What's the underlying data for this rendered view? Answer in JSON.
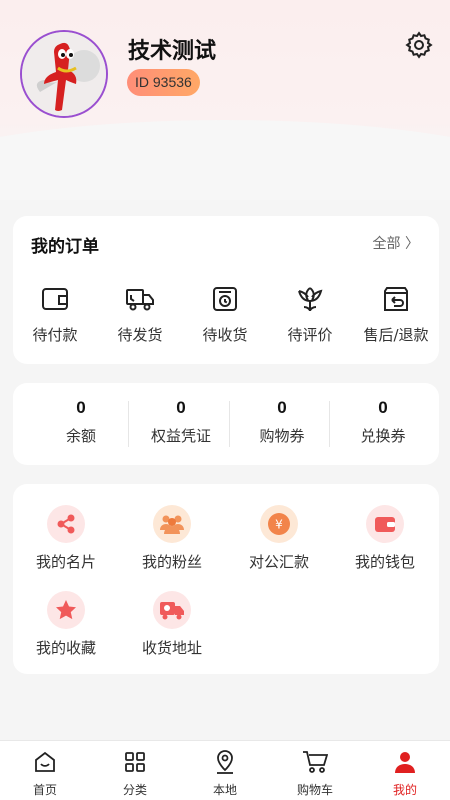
{
  "profile": {
    "name": "技术测试",
    "id_label": "ID 93536"
  },
  "orders": {
    "title": "我的订单",
    "all_label": "全部 〉",
    "items": [
      {
        "label": "待付款",
        "icon": "wallet-icon"
      },
      {
        "label": "待发货",
        "icon": "truck-icon"
      },
      {
        "label": "待收货",
        "icon": "package-clock-icon"
      },
      {
        "label": "待评价",
        "icon": "flower-icon"
      },
      {
        "label": "售后/退款",
        "icon": "return-icon"
      }
    ]
  },
  "stats": [
    {
      "value": "0",
      "label": "余额"
    },
    {
      "value": "0",
      "label": "权益凭证"
    },
    {
      "value": "0",
      "label": "购物券"
    },
    {
      "value": "0",
      "label": "兑换券"
    }
  ],
  "services": [
    {
      "label": "我的名片",
      "icon": "share-icon"
    },
    {
      "label": "我的粉丝",
      "icon": "fans-icon"
    },
    {
      "label": "对公汇款",
      "icon": "yuan-icon"
    },
    {
      "label": "我的钱包",
      "icon": "wallet-icon"
    },
    {
      "label": "我的收藏",
      "icon": "star-icon"
    },
    {
      "label": "收货地址",
      "icon": "delivery-truck-icon"
    }
  ],
  "tabs": [
    {
      "label": "首页",
      "icon": "home-icon"
    },
    {
      "label": "分类",
      "icon": "grid-icon"
    },
    {
      "label": "本地",
      "icon": "location-pin-icon"
    },
    {
      "label": "购物车",
      "icon": "cart-icon"
    },
    {
      "label": "我的",
      "icon": "person-icon",
      "active": true
    }
  ],
  "colors": {
    "accent": "#e02020",
    "badge_start": "#ff8e78",
    "badge_end": "#ffa866",
    "avatar_border": "#9a4fd0"
  }
}
